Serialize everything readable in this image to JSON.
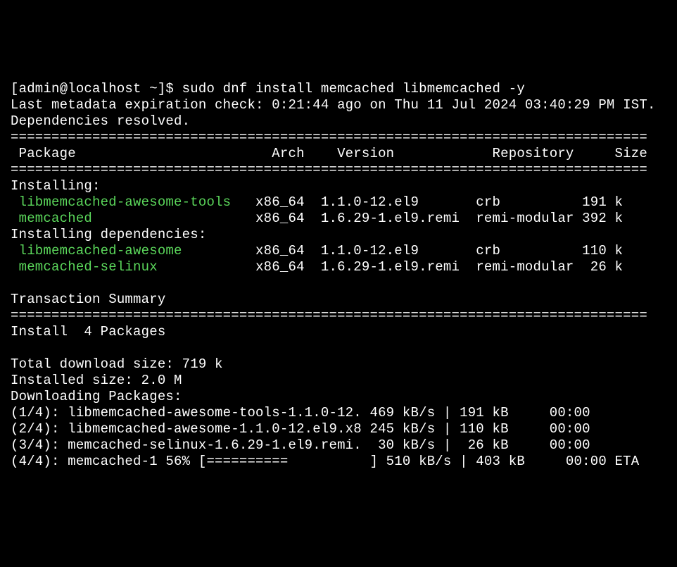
{
  "prompt": "[admin@localhost ~]$ sudo dnf install memcached libmemcached -y",
  "metadata_line": "Last metadata expiration check: 0:21:44 ago on Thu 11 Jul 2024 03:40:29 PM IST.",
  "deps_resolved": "Dependencies resolved.",
  "divider": "==============================================================================",
  "header": " Package                        Arch    Version            Repository     Size",
  "installing_header": "Installing:",
  "installing_deps_header": "Installing dependencies:",
  "transaction_summary": "Transaction Summary",
  "install_count": "Install  4 Packages",
  "download_size": "Total download size: 719 k",
  "installed_size": "Installed size: 2.0 M",
  "downloading": "Downloading Packages:",
  "pkg1_name": " libmemcached-awesome-tools",
  "pkg1_rest": "   x86_64  1.1.0-12.el9       crb          191 k",
  "pkg2_name": " memcached",
  "pkg2_rest": "                    x86_64  1.6.29-1.el9.remi  remi-modular 392 k",
  "pkg3_name": " libmemcached-awesome",
  "pkg3_rest": "         x86_64  1.1.0-12.el9       crb          110 k",
  "pkg4_name": " memcached-selinux",
  "pkg4_rest": "            x86_64  1.6.29-1.el9.remi  remi-modular  26 k",
  "dl1": "(1/4): libmemcached-awesome-tools-1.1.0-12. 469 kB/s | 191 kB     00:00",
  "dl2": "(2/4): libmemcached-awesome-1.1.0-12.el9.x8 245 kB/s | 110 kB     00:00",
  "dl3": "(3/4): memcached-selinux-1.6.29-1.el9.remi.  30 kB/s |  26 kB     00:00",
  "dl4": "(4/4): memcached-1 56% [==========          ] 510 kB/s | 403 kB     00:00 ETA",
  "chart_data": {
    "type": "table",
    "packages": [
      {
        "name": "libmemcached-awesome-tools",
        "arch": "x86_64",
        "version": "1.1.0-12.el9",
        "repository": "crb",
        "size": "191 k",
        "type": "install"
      },
      {
        "name": "memcached",
        "arch": "x86_64",
        "version": "1.6.29-1.el9.remi",
        "repository": "remi-modular",
        "size": "392 k",
        "type": "install"
      },
      {
        "name": "libmemcached-awesome",
        "arch": "x86_64",
        "version": "1.1.0-12.el9",
        "repository": "crb",
        "size": "110 k",
        "type": "dependency"
      },
      {
        "name": "memcached-selinux",
        "arch": "x86_64",
        "version": "1.6.29-1.el9.remi",
        "repository": "remi-modular",
        "size": "26 k",
        "type": "dependency"
      }
    ],
    "downloads": [
      {
        "index": "1/4",
        "file": "libmemcached-awesome-tools-1.1.0-12.",
        "speed": "469 kB/s",
        "size": "191 kB",
        "time": "00:00"
      },
      {
        "index": "2/4",
        "file": "libmemcached-awesome-1.1.0-12.el9.x8",
        "speed": "245 kB/s",
        "size": "110 kB",
        "time": "00:00"
      },
      {
        "index": "3/4",
        "file": "memcached-selinux-1.6.29-1.el9.remi.",
        "speed": "30 kB/s",
        "size": "26 kB",
        "time": "00:00"
      },
      {
        "index": "4/4",
        "file": "memcached-1",
        "progress": "56%",
        "speed": "510 kB/s",
        "size": "403 kB",
        "eta": "00:00 ETA"
      }
    ],
    "summary": {
      "install_count": 4,
      "total_download_size": "719 k",
      "installed_size": "2.0 M"
    }
  }
}
